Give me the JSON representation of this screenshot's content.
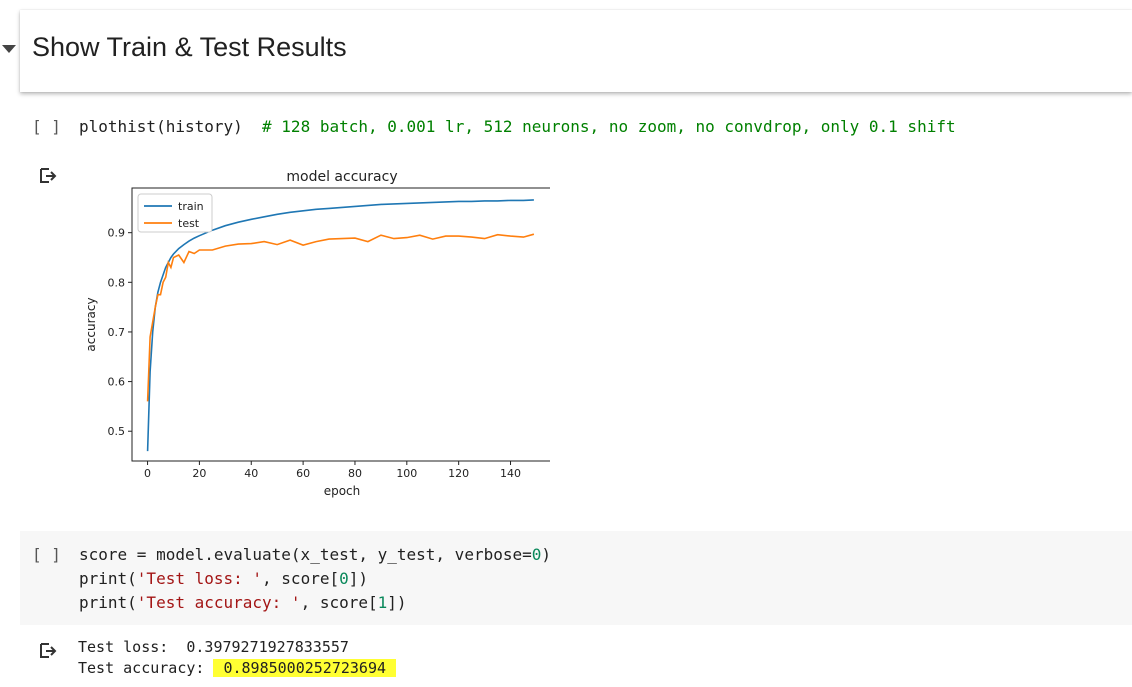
{
  "section": {
    "title": "Show Train & Test Results"
  },
  "cell1": {
    "run_label": "[ ]",
    "code_prefix": "plothist(history)  ",
    "comment": "# 128 batch, 0.001 lr, 512 neurons, no zoom, no convdrop, only 0.1 shift"
  },
  "cell2": {
    "run_label": "[ ]",
    "line1_a": "score = model.evaluate(x_test, y_test, verbose=",
    "line1_num": "0",
    "line1_b": ")",
    "line2_a": "print(",
    "line2_str": "'Test loss: '",
    "line2_b": ", score[",
    "line2_num": "0",
    "line2_c": "])",
    "line3_a": "print(",
    "line3_str": "'Test accuracy: '",
    "line3_b": ", score[",
    "line3_num": "1",
    "line3_c": "])"
  },
  "output2": {
    "loss_label": "Test loss:  ",
    "loss_value": "0.3979271927833557",
    "acc_label": "Test accuracy: ",
    "acc_value": "0.8985000252723694",
    "highlight_color": "#ffff33"
  },
  "icons": {
    "output": "output-arrow-icon"
  },
  "chart_data": {
    "type": "line",
    "title": "model accuracy",
    "xlabel": "epoch",
    "ylabel": "accuracy",
    "xlim": [
      -6,
      156
    ],
    "ylim": [
      0.44,
      0.99
    ],
    "xticks": [
      0,
      20,
      40,
      60,
      80,
      100,
      120,
      140
    ],
    "yticks": [
      0.5,
      0.6,
      0.7,
      0.8,
      0.9
    ],
    "legend_position": "top-left",
    "grid": false,
    "x": [
      0,
      1,
      2,
      3,
      4,
      5,
      6,
      7,
      8,
      9,
      10,
      12,
      14,
      16,
      18,
      20,
      25,
      30,
      35,
      40,
      45,
      50,
      55,
      60,
      65,
      70,
      75,
      80,
      85,
      90,
      95,
      100,
      105,
      110,
      115,
      120,
      125,
      130,
      135,
      140,
      145,
      149
    ],
    "series": [
      {
        "name": "train",
        "color": "#1f77b4",
        "values": [
          0.46,
          0.62,
          0.7,
          0.75,
          0.78,
          0.8,
          0.815,
          0.83,
          0.84,
          0.85,
          0.857,
          0.868,
          0.876,
          0.883,
          0.889,
          0.894,
          0.905,
          0.914,
          0.921,
          0.927,
          0.932,
          0.937,
          0.941,
          0.944,
          0.947,
          0.949,
          0.951,
          0.953,
          0.955,
          0.957,
          0.958,
          0.959,
          0.96,
          0.961,
          0.962,
          0.963,
          0.963,
          0.964,
          0.964,
          0.965,
          0.965,
          0.966
        ]
      },
      {
        "name": "test",
        "color": "#ff7f0e",
        "values": [
          0.56,
          0.69,
          0.72,
          0.75,
          0.775,
          0.775,
          0.8,
          0.81,
          0.84,
          0.83,
          0.85,
          0.855,
          0.84,
          0.862,
          0.858,
          0.865,
          0.865,
          0.873,
          0.877,
          0.878,
          0.882,
          0.876,
          0.885,
          0.875,
          0.882,
          0.887,
          0.888,
          0.889,
          0.882,
          0.895,
          0.888,
          0.89,
          0.895,
          0.887,
          0.893,
          0.893,
          0.891,
          0.888,
          0.896,
          0.893,
          0.891,
          0.897
        ]
      }
    ]
  }
}
